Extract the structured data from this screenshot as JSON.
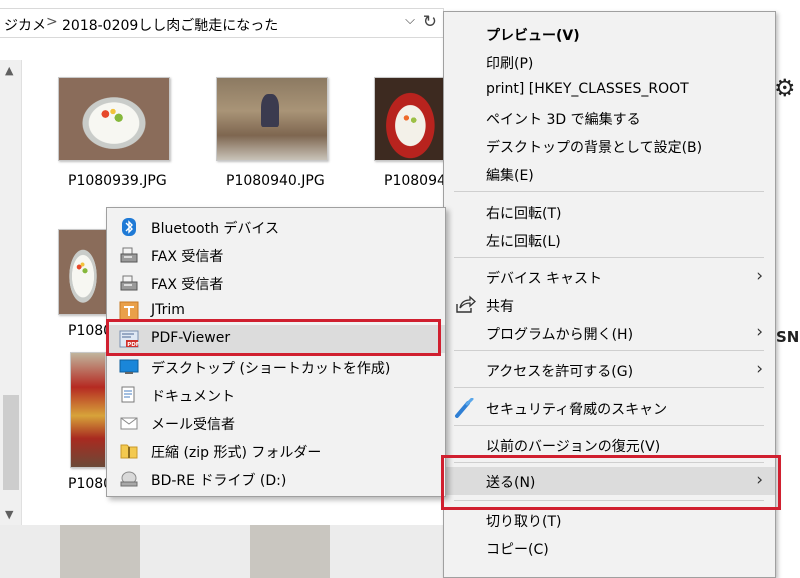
{
  "address": {
    "segments": [
      "ジカメ",
      "2018-0209しし肉ご馳走になった"
    ],
    "separator": ">"
  },
  "files": {
    "row1": [
      "P1080939.JPG",
      "P1080940.JPG",
      "P108094"
    ],
    "row2_partial": "P1080",
    "row3_partial": "P1080"
  },
  "right_edge_text": "SN",
  "context_menu": {
    "items": [
      {
        "label": "プレビュー(V)",
        "bold": true
      },
      {
        "label": "印刷(P)"
      },
      {
        "label": "print] [HKEY_CLASSES_ROOT"
      },
      {
        "label": "ペイント 3D で編集する"
      },
      {
        "label": "デスクトップの背景として設定(B)"
      },
      {
        "label": "編集(E)"
      },
      {
        "label": "右に回転(T)"
      },
      {
        "label": "左に回転(L)"
      },
      {
        "label": "デバイス キャスト",
        "submenu": true
      },
      {
        "label": "共有",
        "icon": "share-icon"
      },
      {
        "label": "プログラムから開く(H)",
        "submenu": true
      },
      {
        "label": "アクセスを許可する(G)",
        "submenu": true
      },
      {
        "label": "セキュリティ脅威のスキャン",
        "icon": "defender-icon"
      },
      {
        "label": "以前のバージョンの復元(V)"
      },
      {
        "label": "送る(N)",
        "submenu": true,
        "highlighted": true
      },
      {
        "label": "切り取り(T)"
      },
      {
        "label": "コピー(C)"
      }
    ]
  },
  "send_to_menu": {
    "items": [
      {
        "label": "Bluetooth デバイス",
        "icon": "bluetooth-icon"
      },
      {
        "label": "FAX 受信者",
        "icon": "fax-icon"
      },
      {
        "label": "FAX 受信者",
        "icon": "fax-icon"
      },
      {
        "label": "JTrim",
        "icon": "jtrim-icon"
      },
      {
        "label": "PDF-Viewer",
        "icon": "pdf-icon",
        "highlighted": true
      },
      {
        "label": "デスクトップ (ショートカットを作成)",
        "icon": "desktop-icon"
      },
      {
        "label": "ドキュメント",
        "icon": "documents-icon"
      },
      {
        "label": "メール受信者",
        "icon": "mail-icon"
      },
      {
        "label": "圧縮 (zip 形式) フォルダー",
        "icon": "zip-folder-icon"
      },
      {
        "label": "BD-RE ドライブ (D:)",
        "icon": "drive-icon"
      }
    ]
  },
  "colors": {
    "highlight_border": "#d01f2f",
    "menu_bg": "#f2f2f2",
    "hover_bg": "#dcdcdc"
  }
}
